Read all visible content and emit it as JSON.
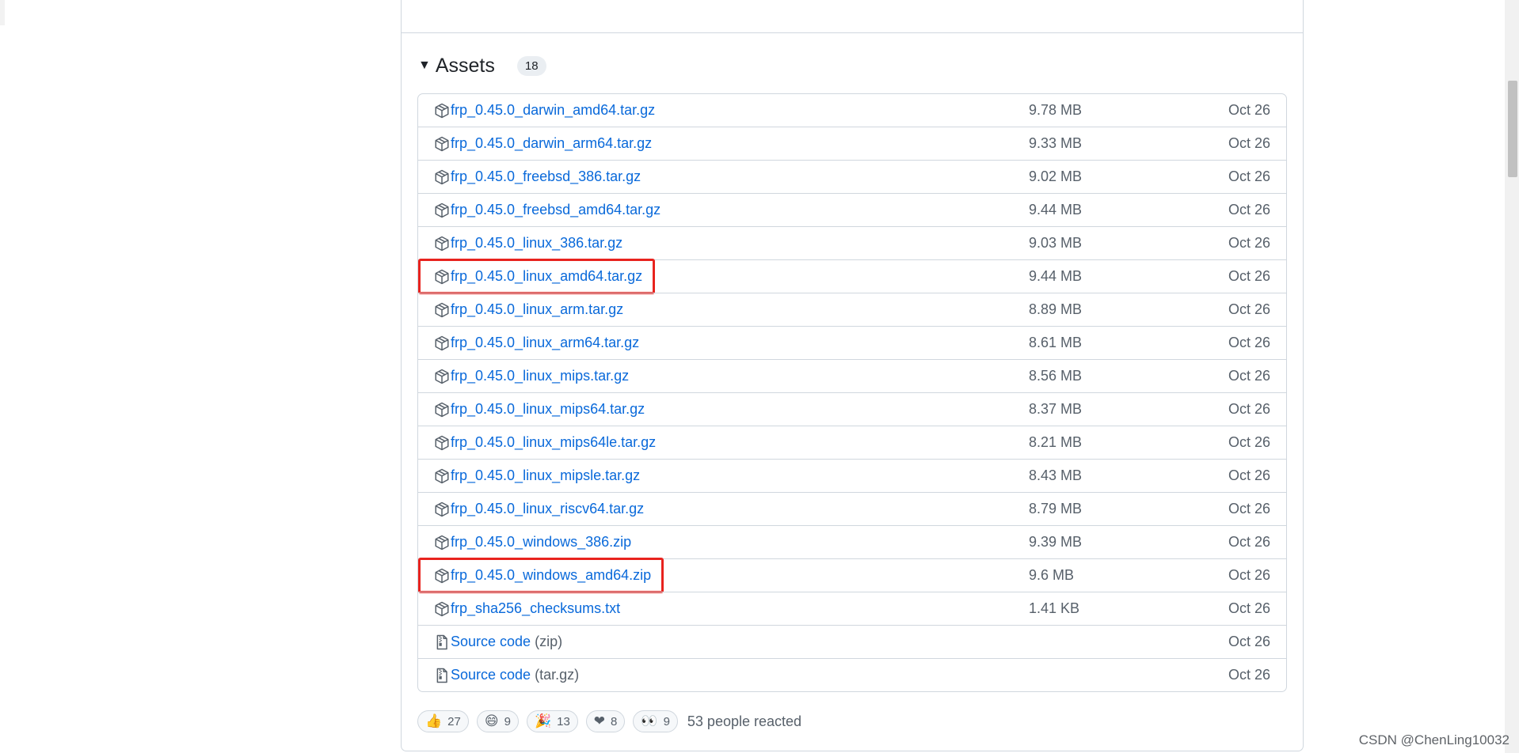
{
  "assets": {
    "title": "Assets",
    "count": "18",
    "items": [
      {
        "name": "frp_0.45.0_darwin_amd64.tar.gz",
        "ext": "",
        "size": "9.78 MB",
        "date": "Oct 26",
        "icon": "package-icon"
      },
      {
        "name": "frp_0.45.0_darwin_arm64.tar.gz",
        "ext": "",
        "size": "9.33 MB",
        "date": "Oct 26",
        "icon": "package-icon"
      },
      {
        "name": "frp_0.45.0_freebsd_386.tar.gz",
        "ext": "",
        "size": "9.02 MB",
        "date": "Oct 26",
        "icon": "package-icon"
      },
      {
        "name": "frp_0.45.0_freebsd_amd64.tar.gz",
        "ext": "",
        "size": "9.44 MB",
        "date": "Oct 26",
        "icon": "package-icon"
      },
      {
        "name": "frp_0.45.0_linux_386.tar.gz",
        "ext": "",
        "size": "9.03 MB",
        "date": "Oct 26",
        "icon": "package-icon"
      },
      {
        "name": "frp_0.45.0_linux_amd64.tar.gz",
        "ext": "",
        "size": "9.44 MB",
        "date": "Oct 26",
        "icon": "package-icon",
        "highlighted": true
      },
      {
        "name": "frp_0.45.0_linux_arm.tar.gz",
        "ext": "",
        "size": "8.89 MB",
        "date": "Oct 26",
        "icon": "package-icon"
      },
      {
        "name": "frp_0.45.0_linux_arm64.tar.gz",
        "ext": "",
        "size": "8.61 MB",
        "date": "Oct 26",
        "icon": "package-icon"
      },
      {
        "name": "frp_0.45.0_linux_mips.tar.gz",
        "ext": "",
        "size": "8.56 MB",
        "date": "Oct 26",
        "icon": "package-icon"
      },
      {
        "name": "frp_0.45.0_linux_mips64.tar.gz",
        "ext": "",
        "size": "8.37 MB",
        "date": "Oct 26",
        "icon": "package-icon"
      },
      {
        "name": "frp_0.45.0_linux_mips64le.tar.gz",
        "ext": "",
        "size": "8.21 MB",
        "date": "Oct 26",
        "icon": "package-icon"
      },
      {
        "name": "frp_0.45.0_linux_mipsle.tar.gz",
        "ext": "",
        "size": "8.43 MB",
        "date": "Oct 26",
        "icon": "package-icon"
      },
      {
        "name": "frp_0.45.0_linux_riscv64.tar.gz",
        "ext": "",
        "size": "8.79 MB",
        "date": "Oct 26",
        "icon": "package-icon"
      },
      {
        "name": "frp_0.45.0_windows_386.zip",
        "ext": "",
        "size": "9.39 MB",
        "date": "Oct 26",
        "icon": "package-icon"
      },
      {
        "name": "frp_0.45.0_windows_amd64.zip",
        "ext": "",
        "size": "9.6 MB",
        "date": "Oct 26",
        "icon": "package-icon",
        "highlighted": true
      },
      {
        "name": "frp_sha256_checksums.txt",
        "ext": "",
        "size": "1.41 KB",
        "date": "Oct 26",
        "icon": "package-icon"
      },
      {
        "name": "Source code",
        "ext": "(zip)",
        "size": "",
        "date": "Oct 26",
        "icon": "file-zip-icon"
      },
      {
        "name": "Source code",
        "ext": "(tar.gz)",
        "size": "",
        "date": "Oct 26",
        "icon": "file-zip-icon"
      }
    ]
  },
  "reactions": {
    "items": [
      {
        "emoji": "👍",
        "count": "27",
        "icon": "thumbs-up-icon"
      },
      {
        "emoji": "😄",
        "count": "9",
        "icon": "laugh-icon"
      },
      {
        "emoji": "🎉",
        "count": "13",
        "icon": "hooray-icon"
      },
      {
        "emoji": "❤",
        "count": "8",
        "icon": "heart-icon"
      },
      {
        "emoji": "👀",
        "count": "9",
        "icon": "eyes-icon"
      }
    ],
    "summary": "53 people reacted"
  },
  "watermark": "CSDN @ChenLing10032",
  "colors": {
    "link": "#0969da",
    "muted": "#57606a",
    "border": "#d0d7de",
    "highlight": "#e8231e"
  }
}
